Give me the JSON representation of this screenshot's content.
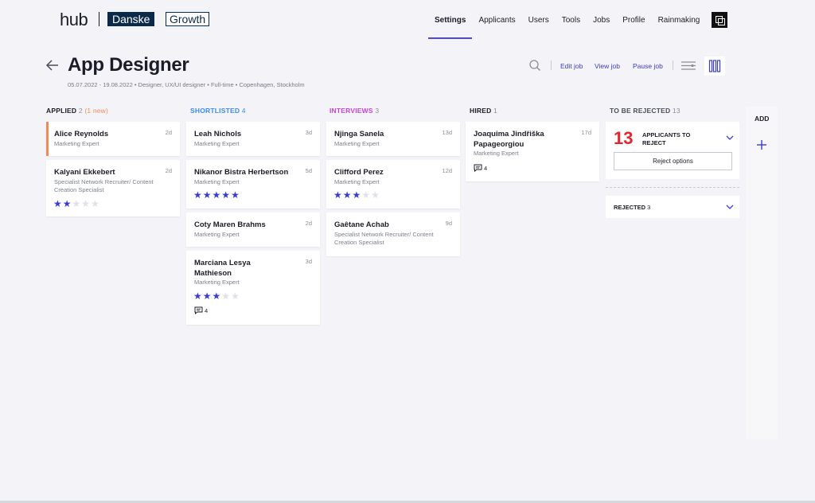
{
  "brand": {
    "hub": "hub",
    "danske": "Danske",
    "growth": "Growth"
  },
  "nav": {
    "items": [
      "Settings",
      "Applicants",
      "Users",
      "Tools",
      "Jobs",
      "Profile",
      "Rainmaking"
    ],
    "active": "Settings"
  },
  "job": {
    "title": "App Designer",
    "meta": "05.07.2022 - 19.08.2022  •  Designer, UX/UI designer  •  Full-time  •  Copenhagen, Stockholm"
  },
  "actions": {
    "edit": "Edit job",
    "view": "View job",
    "pause": "Pause job"
  },
  "colors": {
    "accent": "#4a4ae0",
    "star": "#3b3bd4",
    "applied": "#1c1c28",
    "applied_new": "#f08a57",
    "shortlisted": "#3d8be8",
    "interviews": "#c645d6",
    "hired": "#1c1c28",
    "reject": "#e0262f"
  },
  "columns": [
    {
      "title": "APPLIED",
      "count": "2",
      "extra": "(1 new)",
      "cards": [
        {
          "name": "Alice Reynolds",
          "role": "Marketing Expert",
          "age": "2d",
          "highlight": true,
          "rating": 0,
          "comments": ""
        },
        {
          "name": "Kalyani Ekkebert",
          "role": "Specialist Network Recruiter/ Content Creation Specialist",
          "age": "2d",
          "rating": 2,
          "comments": ""
        }
      ]
    },
    {
      "title": "SHORTLISTED",
      "count": "4",
      "extra": "",
      "cards": [
        {
          "name": "Leah Nichols",
          "role": "Marketing Expert",
          "age": "3d",
          "rating": 0,
          "comments": ""
        },
        {
          "name": "Nikanor Bistra Herbertson",
          "role": "Marketing Expert",
          "age": "5d",
          "rating": 5,
          "comments": ""
        },
        {
          "name": "Coty Maren Brahms",
          "role": "Marketing Expert",
          "age": "2d",
          "rating": 0,
          "comments": ""
        },
        {
          "name": "Marciana Lesya Mathieson",
          "role": "Marketing Expert",
          "age": "3d",
          "rating": 3,
          "comments": "4"
        }
      ]
    },
    {
      "title": "INTERVIEWS",
      "count": "3",
      "extra": "",
      "cards": [
        {
          "name": "Njinga Sanela",
          "role": "Marketing Expert",
          "age": "13d",
          "rating": 0,
          "comments": ""
        },
        {
          "name": "Clifford Perez",
          "role": "Marketing Expert",
          "age": "12d",
          "rating": 3,
          "comments": ""
        },
        {
          "name": "Gaêtane Achab",
          "role": "Specialist Network Recruiter/ Content Creation Specialist",
          "age": "9d",
          "rating": 0,
          "comments": ""
        }
      ]
    },
    {
      "title": "HIRED",
      "count": "1",
      "extra": "",
      "cards": [
        {
          "name": "Joaquima Jindřiška Papageorgiou",
          "role": "Marketing Expert",
          "age": "17d",
          "rating": 0,
          "comments": "4"
        }
      ]
    }
  ],
  "to_reject": {
    "title": "TO BE REJECTED",
    "count": "13",
    "number": "13",
    "label": "APPLICANTS TO REJECT",
    "button": "Reject options"
  },
  "rejected": {
    "title": "REJECTED",
    "count": "3"
  },
  "add": {
    "title": "ADD"
  }
}
